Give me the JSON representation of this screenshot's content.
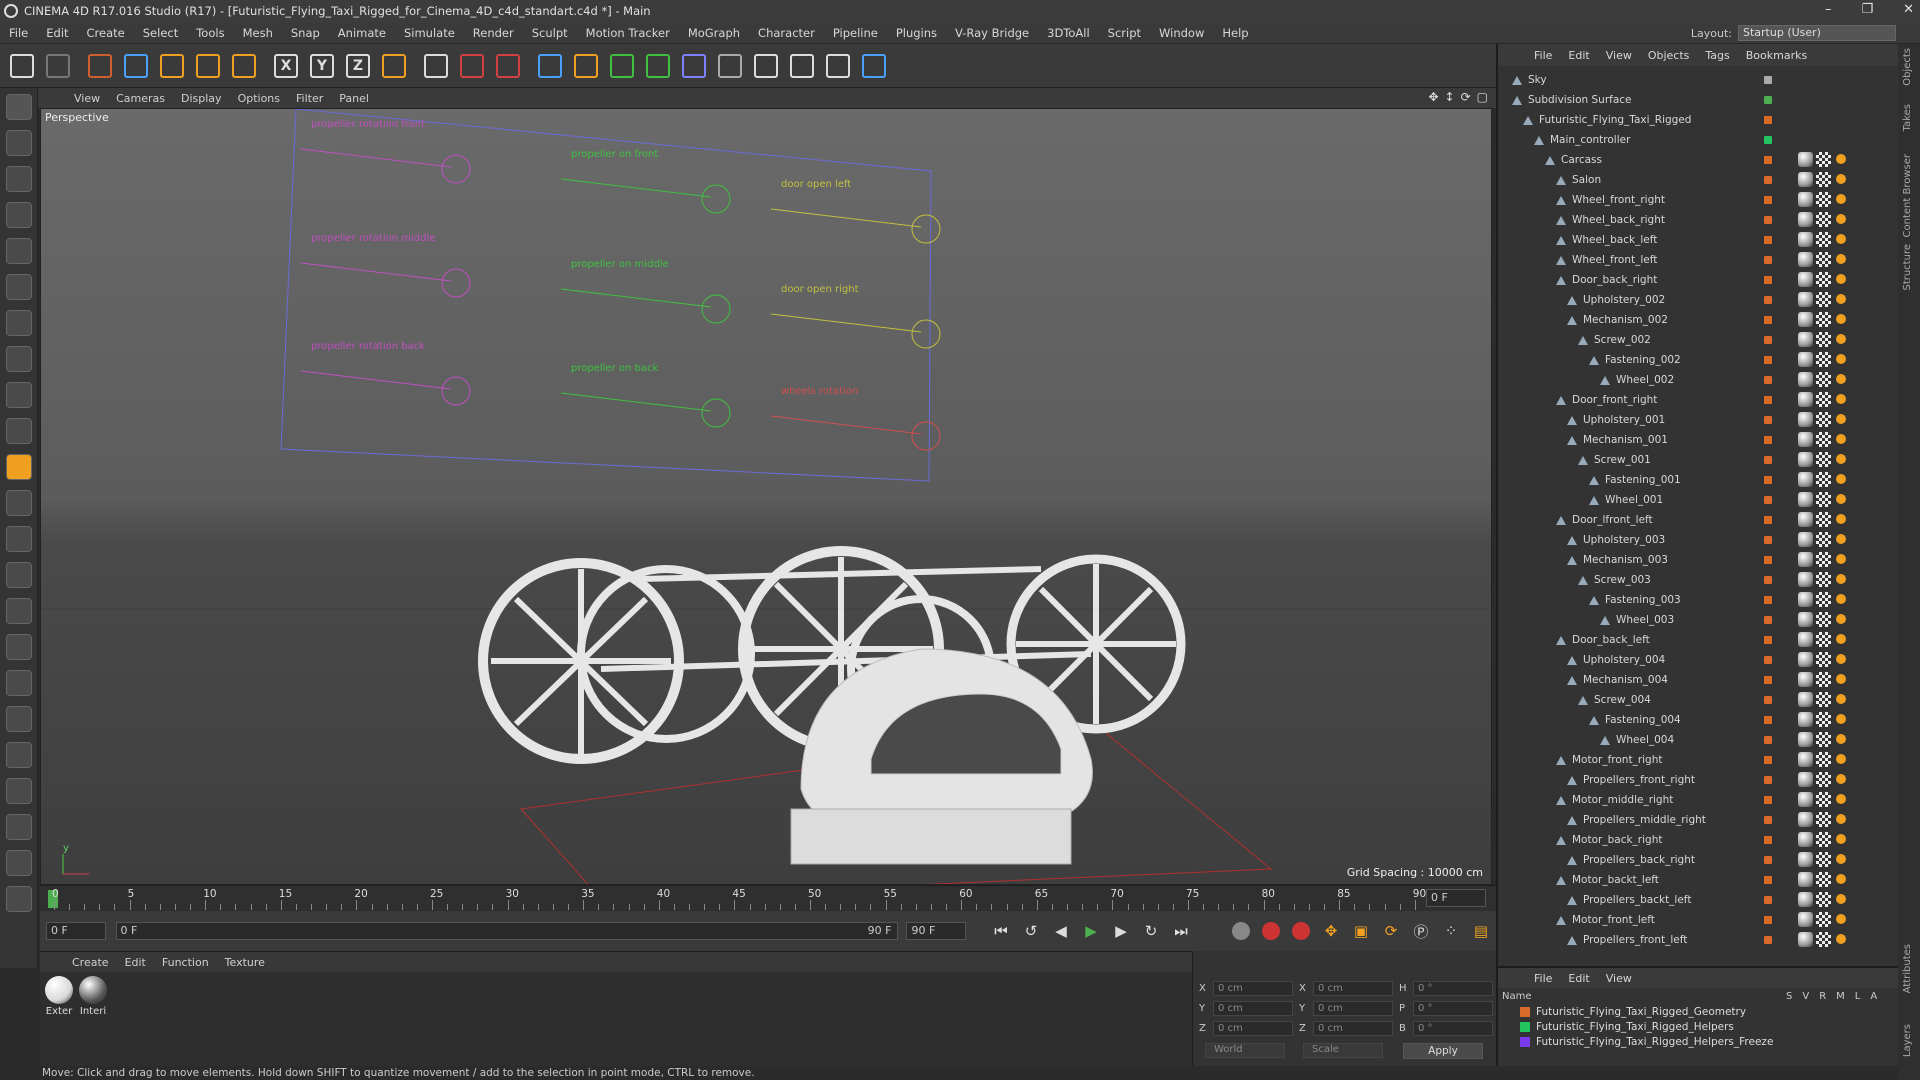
{
  "window": {
    "title": "CINEMA 4D R17.016 Studio (R17) - [Futuristic_Flying_Taxi_Rigged_for_Cinema_4D_c4d_standart.c4d *] - Main",
    "controls": [
      "–",
      "❐",
      "✕"
    ]
  },
  "menu": [
    "File",
    "Edit",
    "Create",
    "Select",
    "Tools",
    "Mesh",
    "Snap",
    "Animate",
    "Simulate",
    "Render",
    "Sculpt",
    "Motion Tracker",
    "MoGraph",
    "Character",
    "Pipeline",
    "Plugins",
    "V-Ray Bridge",
    "3DToAll",
    "Script",
    "Window",
    "Help"
  ],
  "layout": {
    "label": "Layout:",
    "value": "Startup (User)"
  },
  "toolbar": {
    "axes": [
      "X",
      "Y",
      "Z"
    ],
    "icons": [
      "undo-icon",
      "redo-icon",
      "live-select-icon",
      "move-icon",
      "scale-icon",
      "rotate-icon",
      "transform-icon",
      "x-axis-icon",
      "y-axis-icon",
      "z-axis-icon",
      "world-coord-icon",
      "render-view-icon",
      "render-picture-viewer-icon",
      "render-settings-icon",
      "cube-icon",
      "pen-icon",
      "subdivision-icon",
      "array-icon",
      "deformer-icon",
      "floor-icon",
      "camera-icon",
      "light-icon",
      "stereo-icon",
      "python-icon"
    ]
  },
  "viewport": {
    "menu": [
      "View",
      "Cameras",
      "Display",
      "Options",
      "Filter",
      "Panel"
    ],
    "label": "Perspective",
    "grid_spacing": "Grid Spacing : 10000 cm",
    "controller_labels": [
      "propeller rotation front",
      "propeller on front",
      "door open left",
      "propeller rotation middle",
      "propeller on middle",
      "door open right",
      "propeller rotation back",
      "propeller on back",
      "wheels rotation"
    ]
  },
  "timeline": {
    "ticks": [
      "0",
      "5",
      "10",
      "15",
      "20",
      "25",
      "30",
      "35",
      "40",
      "45",
      "50",
      "55",
      "60",
      "65",
      "70",
      "75",
      "80",
      "85",
      "90"
    ],
    "current_frame": "0 F",
    "end_field": "0 F",
    "start_field": "0 F",
    "range_start": "0 F",
    "range_end": "90 F",
    "max_field": "90 F"
  },
  "materials": {
    "menu": [
      "Create",
      "Edit",
      "Function",
      "Texture"
    ],
    "items": [
      {
        "name": "Exter",
        "color": "#d8d8d8"
      },
      {
        "name": "Interi",
        "color": "#5a5a5a"
      }
    ]
  },
  "coords": {
    "rows": [
      {
        "a": "X",
        "av": "0 cm",
        "b": "X",
        "bv": "0 cm",
        "c": "H",
        "cv": "0 °"
      },
      {
        "a": "Y",
        "av": "0 cm",
        "b": "Y",
        "bv": "0 cm",
        "c": "P",
        "cv": "0 °"
      },
      {
        "a": "Z",
        "av": "0 cm",
        "b": "Z",
        "bv": "0 cm",
        "c": "B",
        "cv": "0 °"
      }
    ],
    "mode": "World",
    "type": "Scale",
    "apply": "Apply",
    "headers": [
      "--",
      "--",
      "--"
    ]
  },
  "status": "Move: Click and drag to move elements. Hold down SHIFT to quantize movement / add to the selection in point mode, CTRL to remove.",
  "objects": {
    "menu": [
      "File",
      "Edit",
      "View",
      "Objects",
      "Tags",
      "Bookmarks"
    ],
    "rows": [
      {
        "name": "Sky",
        "indent": 0,
        "color": "#aaa"
      },
      {
        "name": "Subdivision Surface",
        "indent": 0,
        "color": "#4caf50"
      },
      {
        "name": "Futuristic_Flying_Taxi_Rigged",
        "indent": 1,
        "color": "#d86a2a"
      },
      {
        "name": "Main_controller",
        "indent": 2,
        "color": "#22c55e"
      },
      {
        "name": "Carcass",
        "indent": 3,
        "color": "#d86a2a"
      },
      {
        "name": "Salon",
        "indent": 4,
        "color": "#d86a2a"
      },
      {
        "name": "Wheel_front_right",
        "indent": 4,
        "color": "#d86a2a"
      },
      {
        "name": "Wheel_back_right",
        "indent": 4,
        "color": "#d86a2a"
      },
      {
        "name": "Wheel_back_left",
        "indent": 4,
        "color": "#d86a2a"
      },
      {
        "name": "Wheel_front_left",
        "indent": 4,
        "color": "#d86a2a"
      },
      {
        "name": "Door_back_right",
        "indent": 4,
        "color": "#d86a2a"
      },
      {
        "name": "Upholstery_002",
        "indent": 5,
        "color": "#d86a2a"
      },
      {
        "name": "Mechanism_002",
        "indent": 5,
        "color": "#d86a2a"
      },
      {
        "name": "Screw_002",
        "indent": 6,
        "color": "#d86a2a"
      },
      {
        "name": "Fastening_002",
        "indent": 7,
        "color": "#d86a2a"
      },
      {
        "name": "Wheel_002",
        "indent": 8,
        "color": "#d86a2a"
      },
      {
        "name": "Door_front_right",
        "indent": 4,
        "color": "#d86a2a"
      },
      {
        "name": "Upholstery_001",
        "indent": 5,
        "color": "#d86a2a"
      },
      {
        "name": "Mechanism_001",
        "indent": 5,
        "color": "#d86a2a"
      },
      {
        "name": "Screw_001",
        "indent": 6,
        "color": "#d86a2a"
      },
      {
        "name": "Fastening_001",
        "indent": 7,
        "color": "#d86a2a"
      },
      {
        "name": "Wheel_001",
        "indent": 7,
        "color": "#d86a2a"
      },
      {
        "name": "Door_lfront_left",
        "indent": 4,
        "color": "#d86a2a"
      },
      {
        "name": "Upholstery_003",
        "indent": 5,
        "color": "#d86a2a"
      },
      {
        "name": "Mechanism_003",
        "indent": 5,
        "color": "#d86a2a"
      },
      {
        "name": "Screw_003",
        "indent": 6,
        "color": "#d86a2a"
      },
      {
        "name": "Fastening_003",
        "indent": 7,
        "color": "#d86a2a"
      },
      {
        "name": "Wheel_003",
        "indent": 8,
        "color": "#d86a2a"
      },
      {
        "name": "Door_back_left",
        "indent": 4,
        "color": "#d86a2a"
      },
      {
        "name": "Upholstery_004",
        "indent": 5,
        "color": "#d86a2a"
      },
      {
        "name": "Mechanism_004",
        "indent": 5,
        "color": "#d86a2a"
      },
      {
        "name": "Screw_004",
        "indent": 6,
        "color": "#d86a2a"
      },
      {
        "name": "Fastening_004",
        "indent": 7,
        "color": "#d86a2a"
      },
      {
        "name": "Wheel_004",
        "indent": 8,
        "color": "#d86a2a"
      },
      {
        "name": "Motor_front_right",
        "indent": 4,
        "color": "#d86a2a"
      },
      {
        "name": "Propellers_front_right",
        "indent": 5,
        "color": "#d86a2a"
      },
      {
        "name": "Motor_middle_right",
        "indent": 4,
        "color": "#d86a2a"
      },
      {
        "name": "Propellers_middle_right",
        "indent": 5,
        "color": "#d86a2a"
      },
      {
        "name": "Motor_back_right",
        "indent": 4,
        "color": "#d86a2a"
      },
      {
        "name": "Propellers_back_right",
        "indent": 5,
        "color": "#d86a2a"
      },
      {
        "name": "Motor_backt_left",
        "indent": 4,
        "color": "#d86a2a"
      },
      {
        "name": "Propellers_backt_left",
        "indent": 5,
        "color": "#d86a2a"
      },
      {
        "name": "Motor_front_left",
        "indent": 4,
        "color": "#d86a2a"
      },
      {
        "name": "Propellers_front_left",
        "indent": 5,
        "color": "#d86a2a"
      }
    ]
  },
  "layers": {
    "menu": [
      "File",
      "Edit",
      "View"
    ],
    "header": "Name",
    "cols": [
      "S",
      "V",
      "R",
      "M",
      "L",
      "A"
    ],
    "rows": [
      {
        "name": "Futuristic_Flying_Taxi_Rigged_Geometry",
        "color": "#d86a2a"
      },
      {
        "name": "Futuristic_Flying_Taxi_Rigged_Helpers",
        "color": "#22c55e"
      },
      {
        "name": "Futuristic_Flying_Taxi_Rigged_Helpers_Freeze",
        "color": "#7c3aed"
      }
    ]
  },
  "side_tabs": [
    "Objects",
    "Takes",
    "Content Browser",
    "Structure",
    "Attributes",
    "Layers"
  ]
}
